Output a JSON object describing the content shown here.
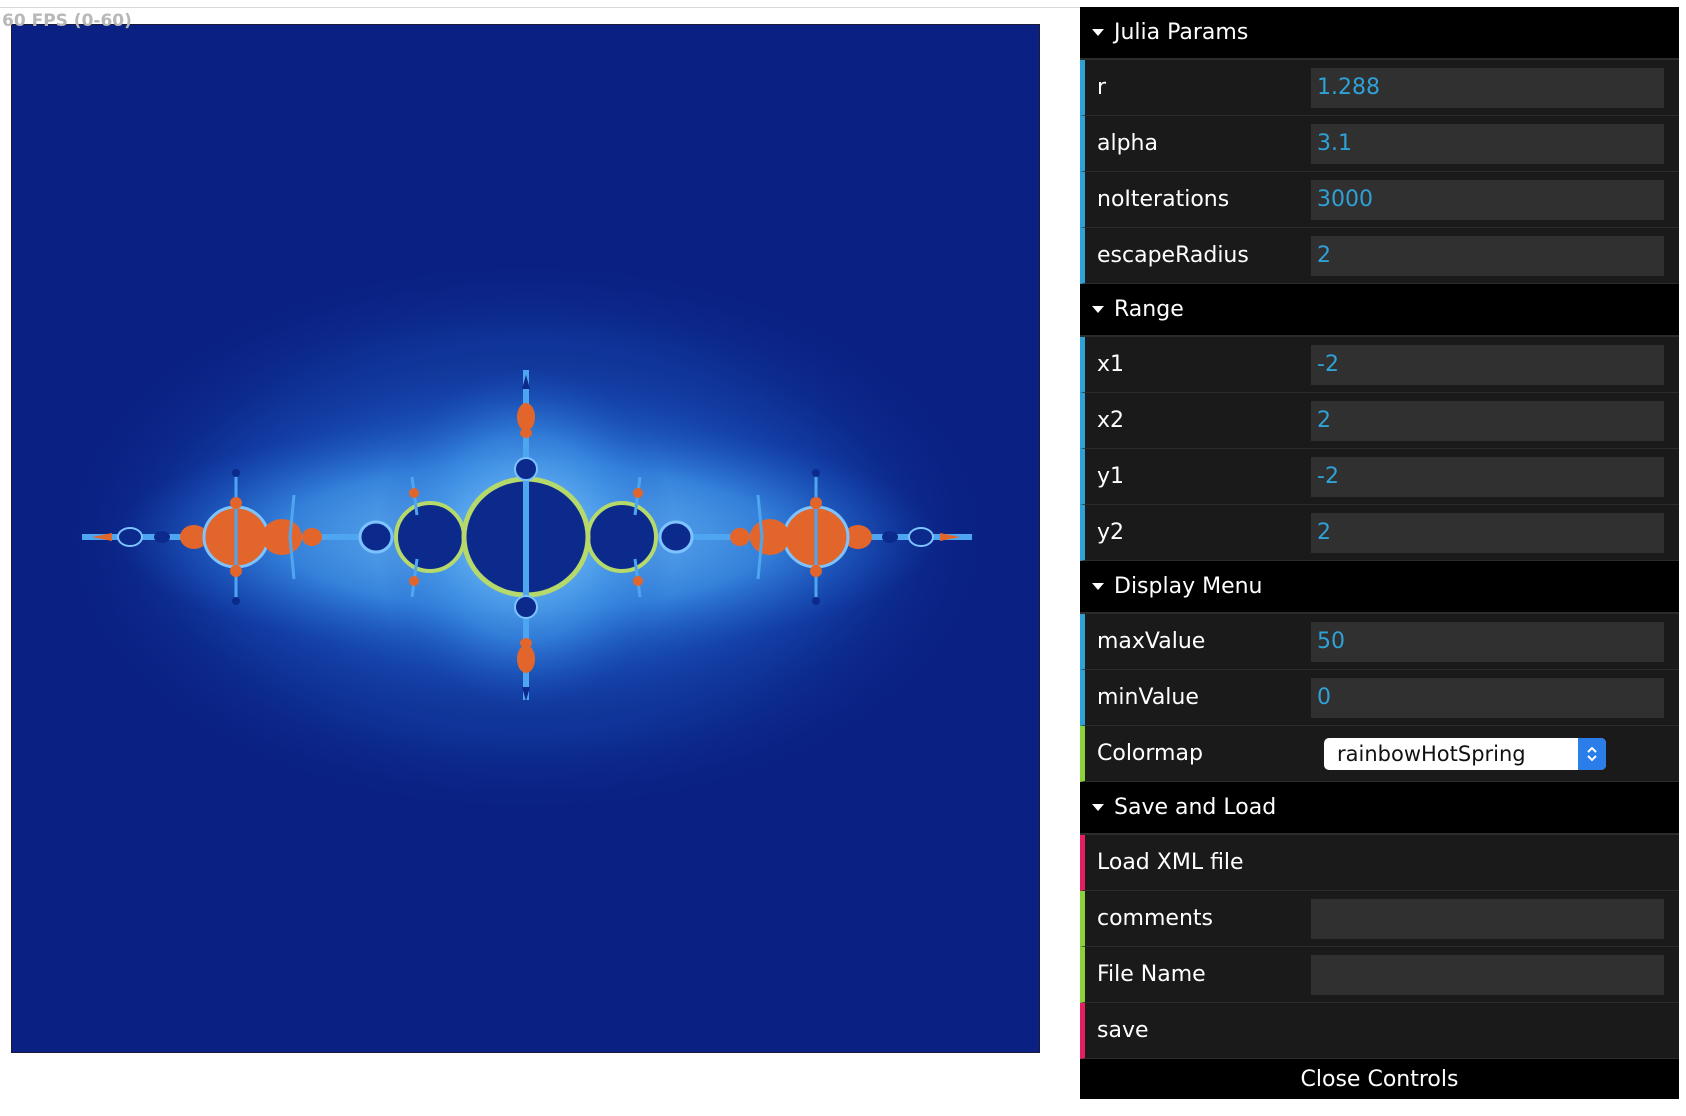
{
  "stats": {
    "fps_text": "60 FPS (0-60)"
  },
  "colors": {
    "background": "#0a2183",
    "set_interior": "#0b2a8c",
    "halo": "#3a8fe0",
    "orange": "#e2662b",
    "folder_accent_number": "#2fa1d6",
    "folder_accent_select": "#8ad13b",
    "folder_accent_function": "#e61d5f"
  },
  "julia_params": {
    "title": "Julia Params",
    "rows": [
      {
        "label": "r",
        "value": "1.288"
      },
      {
        "label": "alpha",
        "value": "3.1"
      },
      {
        "label": "noIterations",
        "value": "3000"
      },
      {
        "label": "escapeRadius",
        "value": "2"
      }
    ]
  },
  "range": {
    "title": "Range",
    "rows": [
      {
        "label": "x1",
        "value": "-2"
      },
      {
        "label": "x2",
        "value": "2"
      },
      {
        "label": "y1",
        "value": "-2"
      },
      {
        "label": "y2",
        "value": "2"
      }
    ]
  },
  "display_menu": {
    "title": "Display Menu",
    "rows": [
      {
        "label": "maxValue",
        "value": "50"
      },
      {
        "label": "minValue",
        "value": "0"
      }
    ],
    "colormap": {
      "label": "Colormap",
      "selected": "rainbowHotSpring"
    }
  },
  "save_load": {
    "title": "Save and Load",
    "load_label": "Load XML file",
    "comments_label": "comments",
    "comments_value": "",
    "filename_label": "File Name",
    "filename_value": "",
    "save_label": "save"
  },
  "close_controls": "Close Controls"
}
